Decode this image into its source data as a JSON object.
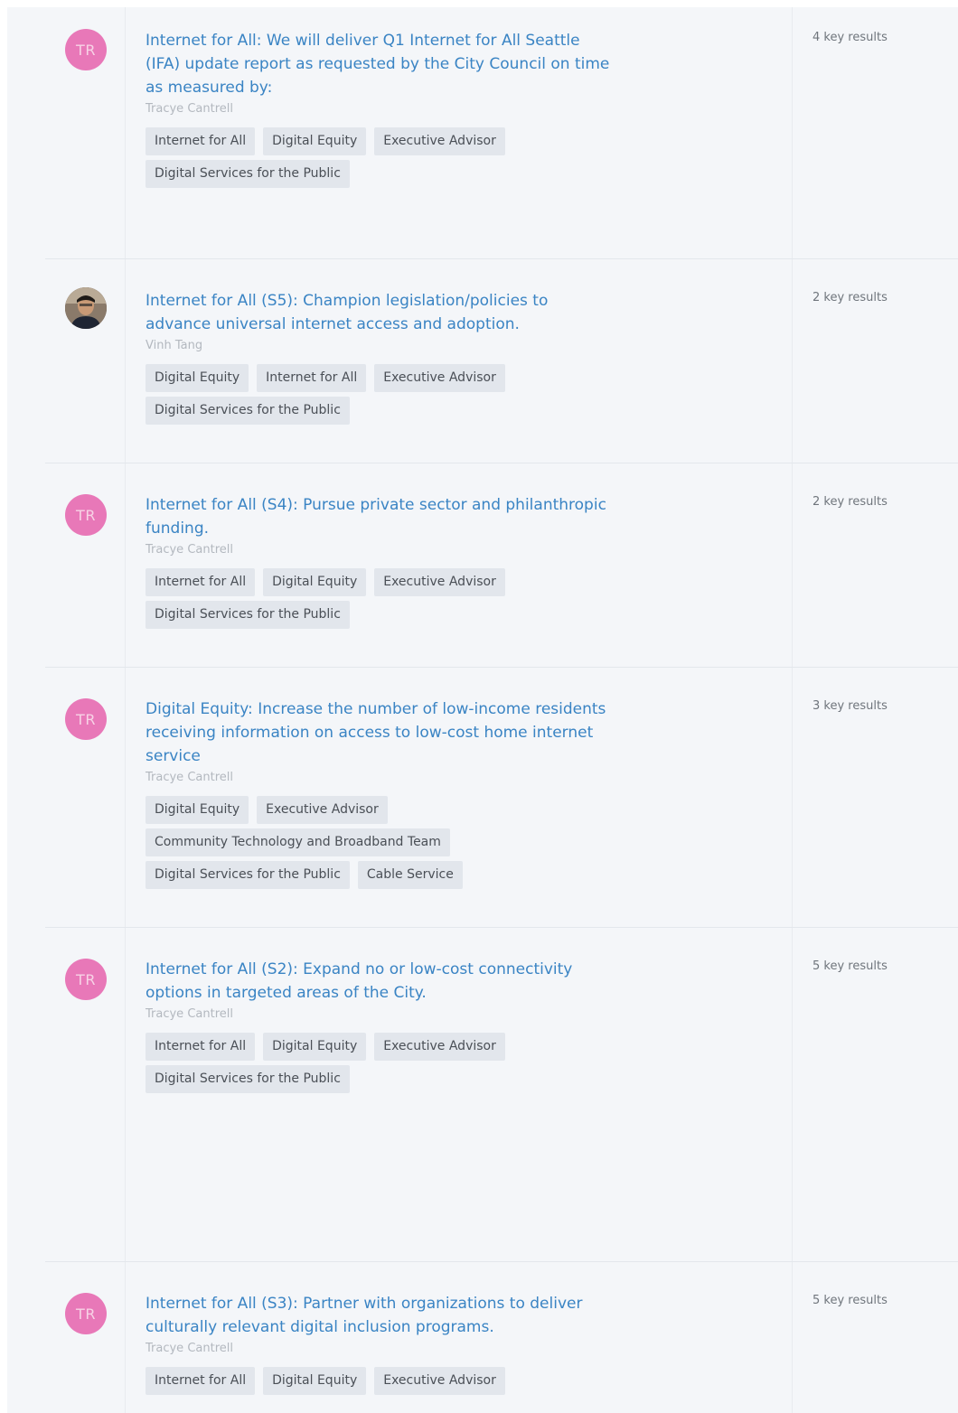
{
  "objectives": [
    {
      "avatar_initials": "TR",
      "avatar_type": "initials",
      "title": "Internet for All: We will deliver Q1 Internet for All Seattle (IFA) update report as requested by the City Council on time as measured by:",
      "owner": "Tracye Cantrell",
      "tags": [
        "Internet for All",
        "Digital Equity",
        "Executive Advisor",
        "Digital Services for the Public"
      ],
      "key_results": "4 key results"
    },
    {
      "avatar_initials": "",
      "avatar_type": "photo",
      "title": "Internet for All (S5): Champion legislation/policies to advance universal internet access and adoption.",
      "owner": "Vinh Tang",
      "tags": [
        "Digital Equity",
        "Internet for All",
        "Executive Advisor",
        "Digital Services for the Public"
      ],
      "key_results": "2 key results"
    },
    {
      "avatar_initials": "TR",
      "avatar_type": "initials",
      "title": "Internet for All (S4): Pursue private sector and philanthropic funding.",
      "owner": "Tracye Cantrell",
      "tags": [
        "Internet for All",
        "Digital Equity",
        "Executive Advisor",
        "Digital Services for the Public"
      ],
      "key_results": "2 key results"
    },
    {
      "avatar_initials": "TR",
      "avatar_type": "initials",
      "title": "Digital Equity: Increase the number of low-income residents receiving information on access to low-cost home internet service",
      "owner": "Tracye Cantrell",
      "tags": [
        "Digital Equity",
        "Executive Advisor",
        "Community Technology and Broadband Team",
        "Digital Services for the Public",
        "Cable Service"
      ],
      "key_results": "3 key results"
    },
    {
      "avatar_initials": "TR",
      "avatar_type": "initials",
      "title": "Internet for All (S2): Expand no or low-cost connectivity options in targeted areas of the City.",
      "owner": "Tracye Cantrell",
      "tags": [
        "Internet for All",
        "Digital Equity",
        "Executive Advisor",
        "Digital Services for the Public"
      ],
      "key_results": "5 key results"
    },
    {
      "avatar_initials": "TR",
      "avatar_type": "initials",
      "title": "Internet for All (S3): Partner with organizations to deliver culturally relevant digital inclusion programs.",
      "owner": "Tracye Cantrell",
      "tags": [
        "Internet for All",
        "Digital Equity",
        "Executive Advisor"
      ],
      "key_results": "5 key results"
    }
  ],
  "colors": {
    "title_link": "#3a84c4",
    "avatar_bg": "#e878b8",
    "tag_bg": "#e2e6ec",
    "page_bg": "#f4f6f9"
  }
}
